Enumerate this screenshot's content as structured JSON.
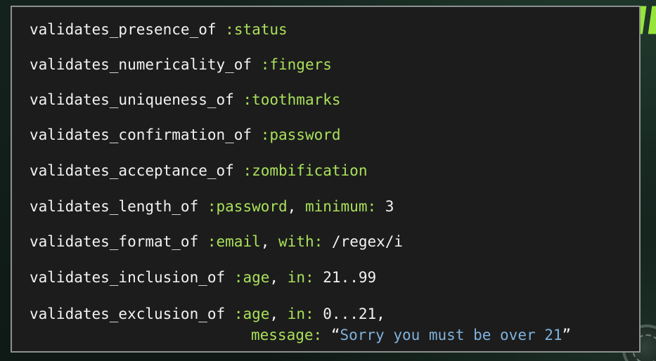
{
  "logo": {
    "text": "VALIDAT"
  },
  "lines": [
    {
      "method": "validates_presence_of",
      "arg": ":status"
    },
    {
      "method": "validates_numericality_of",
      "arg": ":fingers"
    },
    {
      "method": "validates_uniqueness_of",
      "arg": ":toothmarks"
    },
    {
      "method": "validates_confirmation_of",
      "arg": ":password"
    },
    {
      "method": "validates_acceptance_of",
      "arg": ":zombification"
    },
    {
      "method": "validates_length_of",
      "arg": ":password",
      "opt_key": "minimum:",
      "opt_val": "3"
    },
    {
      "method": "validates_format_of",
      "arg": ":email",
      "opt_key": "with:",
      "opt_val": "/regex/i"
    },
    {
      "method": "validates_inclusion_of",
      "arg": ":age",
      "opt_key": "in:",
      "opt_val": "21..99"
    },
    {
      "method": "validates_exclusion_of",
      "arg": ":age",
      "opt_key": "in:",
      "opt_val": "0...21",
      "trail": ","
    }
  ],
  "continuation": {
    "key": "message:",
    "open_quote": "“",
    "text": "Sorry you must be over 21",
    "close_quote": "”"
  }
}
